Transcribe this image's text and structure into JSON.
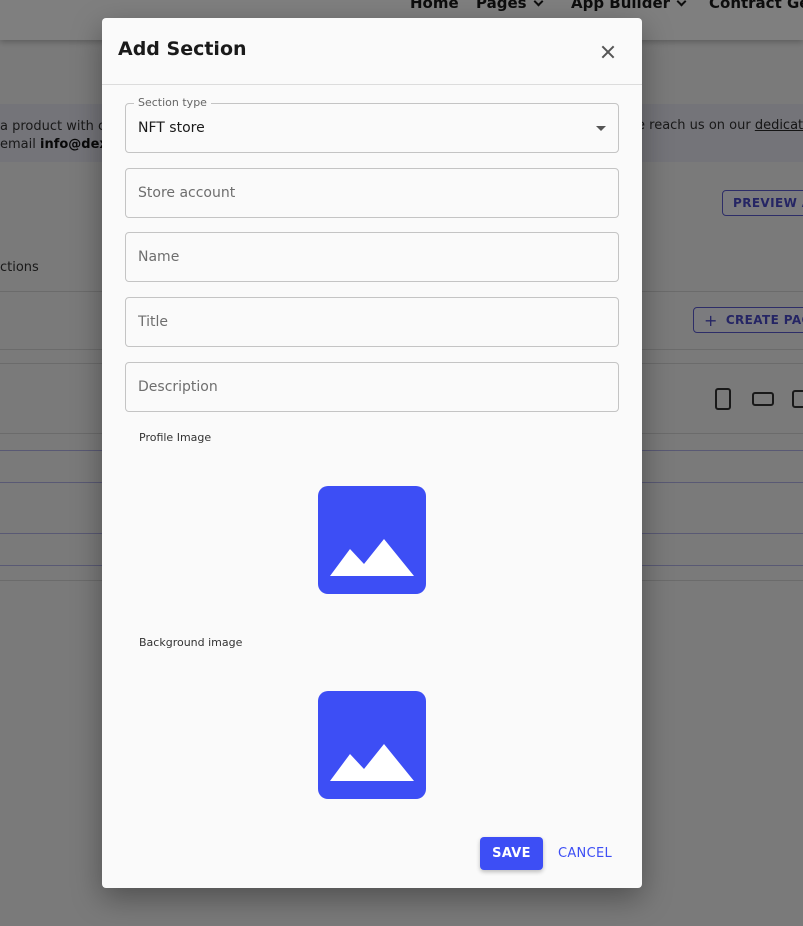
{
  "nav": {
    "home": "Home",
    "pages": "Pages",
    "app_builder": "App Builder",
    "contract_gen": "Contract Gen"
  },
  "background": {
    "banner_line1": "a product with c",
    "banner_line2_prefix": "email ",
    "banner_line2_bold": "info@dex",
    "banner_right_prefix": "e reach us on our ",
    "banner_right_link": "dedicate",
    "preview_button": "PREVIEW AP",
    "sections_text": "ctions",
    "create_page_button": "CREATE PAGE"
  },
  "dialog": {
    "title": "Add Section",
    "section_type": {
      "label": "Section type",
      "value": "NFT store"
    },
    "fields": {
      "store_account": "Store account",
      "name": "Name",
      "title": "Title",
      "description": "Description"
    },
    "profile_image_label": "Profile Image",
    "background_image_label": "Background image",
    "save_label": "SAVE",
    "cancel_label": "CANCEL"
  },
  "colors": {
    "accent": "#3d4ef5",
    "overlay": "rgba(0,0,0,0.5)"
  },
  "icons": {
    "close": "close-icon",
    "select_arrow": "dropdown-arrow-icon",
    "image_placeholder": "image-placeholder-icon",
    "phone": "smartphone-icon",
    "laptop": "laptop-icon",
    "tablet": "devices-icon",
    "plus": "plus-icon"
  }
}
